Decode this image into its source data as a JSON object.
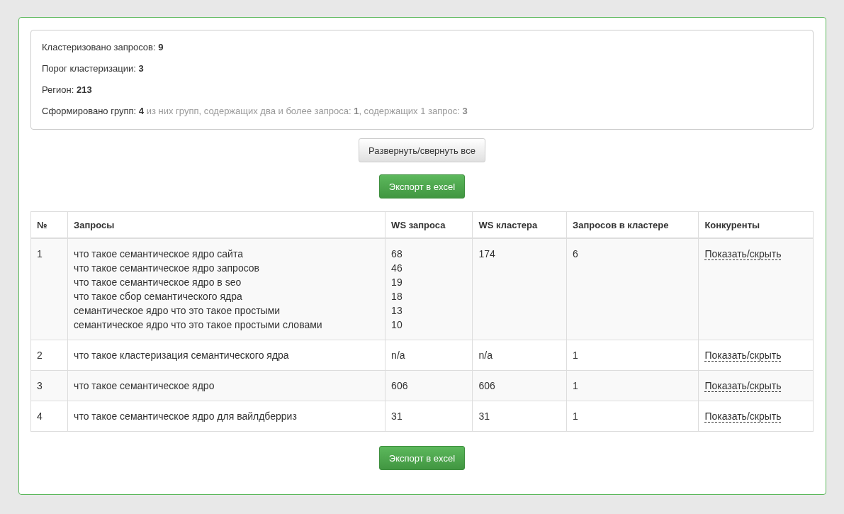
{
  "summary": [
    {
      "label": "Кластеризовано запросов:",
      "value": "9"
    },
    {
      "label": "Порог кластеризации:",
      "value": "3"
    },
    {
      "label": "Регион:",
      "value": "213"
    },
    {
      "label": "Сформировано групп:",
      "value": "4",
      "details": [
        {
          "text": "из них групп, содержащих два и более запроса:",
          "value": "1"
        },
        {
          "text": ", содержащих 1 запрос:",
          "value": "3"
        }
      ]
    }
  ],
  "toggle_button": "Развернуть/свернуть все",
  "export_button_top": "Экспорт в excel",
  "table": {
    "columns": [
      "№",
      "Запросы",
      "WS запроса",
      "WS кластера",
      "Запросов в кластере",
      "Конкуренты"
    ],
    "rows": [
      {
        "number": "1",
        "queries": [
          {
            "text": "что такое семантическое ядро сайта",
            "ws": "68"
          },
          {
            "text": "что такое семантическое ядро запросов",
            "ws": "46"
          },
          {
            "text": "что такое семантическое ядро в seo",
            "ws": "19"
          },
          {
            "text": "что такое сбор семантического ядра",
            "ws": "18"
          },
          {
            "text": "семантическое ядро что это такое простыми",
            "ws": "13"
          },
          {
            "text": "семантическое ядро что это такое простыми словами",
            "ws": "10"
          }
        ],
        "cluster_ws": "174",
        "cluster_count": "6",
        "competitors_link": "Показать/скрыть"
      },
      {
        "number": "2",
        "queries": [
          {
            "text": "что такое кластеризация семантического ядра",
            "ws": "n/a"
          }
        ],
        "cluster_ws": "n/a",
        "cluster_count": "1",
        "competitors_link": "Показать/скрыть"
      },
      {
        "number": "3",
        "queries": [
          {
            "text": "что такое семантическое ядро",
            "ws": "606"
          }
        ],
        "cluster_ws": "606",
        "cluster_count": "1",
        "competitors_link": "Показать/скрыть"
      },
      {
        "number": "4",
        "queries": [
          {
            "text": "что такое семантическое ядро для вайлдберриз",
            "ws": "31"
          }
        ],
        "cluster_ws": "31",
        "cluster_count": "1",
        "competitors_link": "Показать/скрыть"
      }
    ]
  },
  "export_button_bottom": "Экспорт в excel"
}
